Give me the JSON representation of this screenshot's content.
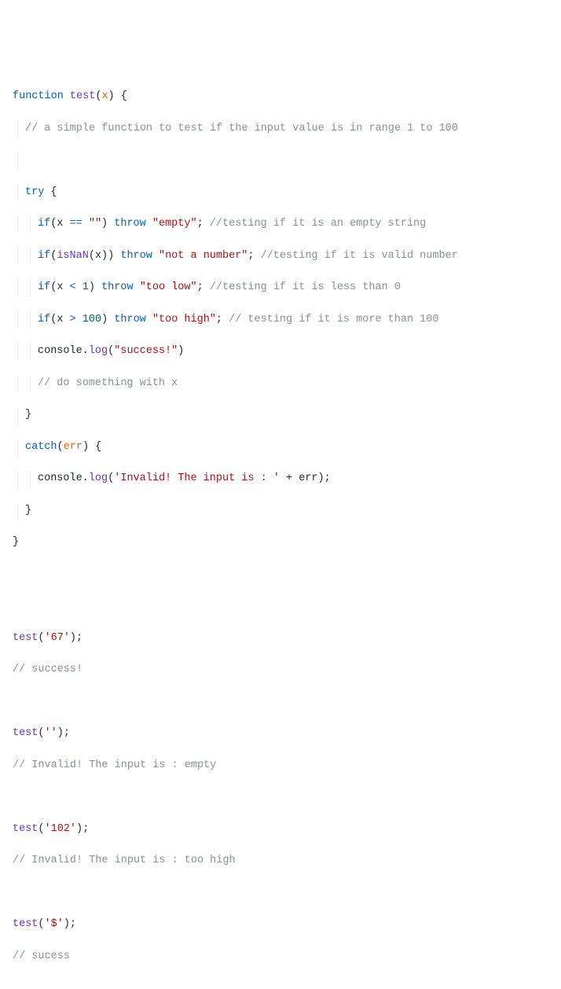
{
  "code": {
    "fn_kw": "function",
    "fn_name": "test",
    "param": "x",
    "c1": "// a simple function to test if the input value is in range 1 to 100",
    "try_kw": "try",
    "if_kw": "if",
    "throw_kw": "throw",
    "catch_kw": "catch",
    "err": "err",
    "l1": {
      "cond_a": "x",
      "op": "==",
      "cond_b": "\"\"",
      "str": "\"empty\"",
      "c": "//testing if it is an empty string"
    },
    "l2": {
      "fn": "isNaN",
      "arg": "x",
      "str": "\"not a number\"",
      "c": "//testing if it is valid number"
    },
    "l3": {
      "cond_a": "x",
      "op": "<",
      "cond_b": "1",
      "str": "\"too low\"",
      "c": "//testing if it is less than 0"
    },
    "l4": {
      "cond_a": "x",
      "op": ">",
      "cond_b": "100",
      "str": "\"too high\"",
      "c": "// testing if it is more than 100"
    },
    "l5": {
      "obj": "console",
      "m": "log",
      "str": "\"success!\""
    },
    "l6": {
      "c": "// do something with x"
    },
    "cat": {
      "obj": "console",
      "m": "log",
      "str": "'Invalid! The input is : '",
      "plus": " + ",
      "var": "err"
    }
  },
  "calls": [
    {
      "fn": "test",
      "arg": "'67'",
      "out": "// success!"
    },
    {
      "fn": "test",
      "arg": "''",
      "out": "// Invalid! The input is : empty"
    },
    {
      "fn": "test",
      "arg": "'102'",
      "out": "// Invalid! The input is : too high"
    },
    {
      "fn": "test",
      "arg": "'$'",
      "out": "// sucess"
    }
  ]
}
